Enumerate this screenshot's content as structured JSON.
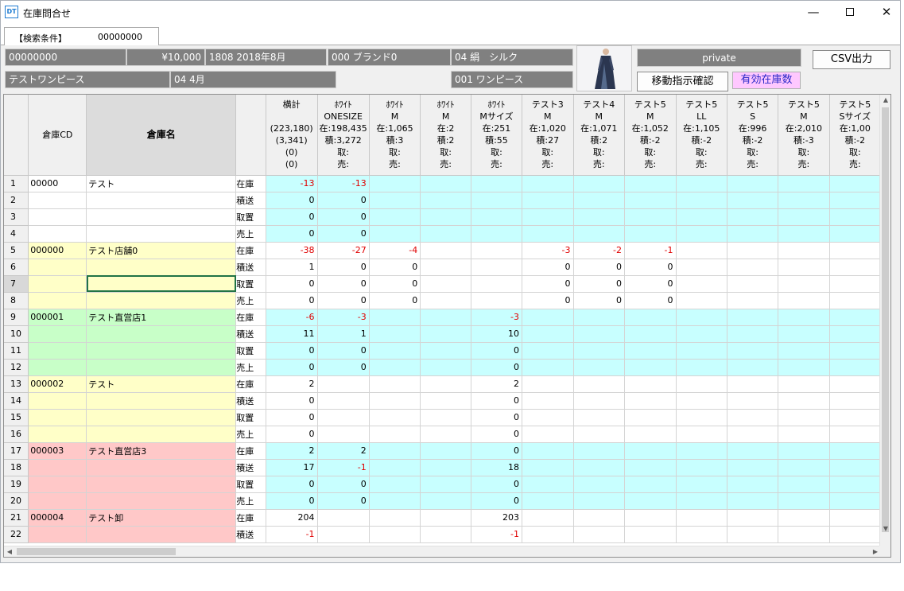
{
  "window": {
    "icon_text": "DT",
    "title": "在庫問合せ",
    "controls": {
      "minimize": "—",
      "close": "✕"
    }
  },
  "tab": {
    "label": "【検索条件】",
    "value": "00000000"
  },
  "info": {
    "code": "00000000",
    "price": "¥10,000",
    "season": "1808 2018年8月",
    "brand": "000 ブランド0",
    "material": "04 絹　シルク",
    "product_name": "テストワンピース",
    "month": "04 4月",
    "category": "001 ワンピース"
  },
  "buttons": {
    "private": "private",
    "move_confirm": "移動指示確認",
    "valid_stock": "有効在庫数",
    "csv": "CSV出力"
  },
  "grid": {
    "headers": {
      "warehouse_cd": "倉庫CD",
      "warehouse_name": "倉庫名",
      "cols": [
        [
          "横計",
          "",
          "(223,180)",
          "(3,341)",
          "(0)",
          "(0)"
        ],
        [
          "ﾎﾜｲﾄ",
          "ONESIZE",
          "在:198,435",
          "積:3,272",
          "取:",
          "売:"
        ],
        [
          "ﾎﾜｲﾄ",
          "M",
          "在:1,065",
          "積:3",
          "取:",
          "売:"
        ],
        [
          "ﾎﾜｲﾄ",
          "M",
          "在:2",
          "積:2",
          "取:",
          "売:"
        ],
        [
          "ﾎﾜｲﾄ",
          "Mサイズ",
          "在:251",
          "積:55",
          "取:",
          "売:"
        ],
        [
          "テスト3",
          "M",
          "在:1,020",
          "積:27",
          "取:",
          "売:"
        ],
        [
          "テスト4",
          "M",
          "在:1,071",
          "積:2",
          "取:",
          "売:"
        ],
        [
          "テスト5",
          "M",
          "在:1,052",
          "積:-2",
          "取:",
          "売:"
        ],
        [
          "テスト5",
          "LL",
          "在:1,105",
          "積:-2",
          "取:",
          "売:"
        ],
        [
          "テスト5",
          "S",
          "在:996",
          "積:-2",
          "取:",
          "売:"
        ],
        [
          "テスト5",
          "M",
          "在:2,010",
          "積:-3",
          "取:",
          "売:"
        ],
        [
          "テスト5",
          "Sサイズ",
          "在:1,00",
          "積:-2",
          "取:",
          "売:"
        ]
      ]
    },
    "groups": [
      {
        "cd": "00000",
        "name": "テスト",
        "color": "#ffffff",
        "data_color": "#c8ffff",
        "rows": [
          {
            "n": "1",
            "label": "在庫",
            "v": [
              "-13",
              "-13",
              "",
              "",
              "",
              "",
              "",
              "",
              "",
              "",
              "",
              ""
            ]
          },
          {
            "n": "2",
            "label": "積送",
            "v": [
              "0",
              "0",
              "",
              "",
              "",
              "",
              "",
              "",
              "",
              "",
              "",
              ""
            ]
          },
          {
            "n": "3",
            "label": "取置",
            "v": [
              "0",
              "0",
              "",
              "",
              "",
              "",
              "",
              "",
              "",
              "",
              "",
              ""
            ]
          },
          {
            "n": "4",
            "label": "売上",
            "v": [
              "0",
              "0",
              "",
              "",
              "",
              "",
              "",
              "",
              "",
              "",
              "",
              ""
            ]
          }
        ]
      },
      {
        "cd": "000000",
        "name": "テスト店舗0",
        "color": "#ffffc8",
        "data_color": "#ffffff",
        "rows": [
          {
            "n": "5",
            "label": "在庫",
            "v": [
              "-38",
              "-27",
              "-4",
              "",
              "",
              "-3",
              "-2",
              "-1",
              "",
              "",
              "",
              ""
            ]
          },
          {
            "n": "6",
            "label": "積送",
            "v": [
              "1",
              "0",
              "0",
              "",
              "",
              "0",
              "0",
              "0",
              "",
              "",
              "",
              ""
            ]
          },
          {
            "n": "7",
            "label": "取置",
            "v": [
              "0",
              "0",
              "0",
              "",
              "",
              "0",
              "0",
              "0",
              "",
              "",
              "",
              ""
            ]
          },
          {
            "n": "8",
            "label": "売上",
            "v": [
              "0",
              "0",
              "0",
              "",
              "",
              "0",
              "0",
              "0",
              "",
              "",
              "",
              ""
            ]
          }
        ]
      },
      {
        "cd": "000001",
        "name": "テスト直営店1",
        "color": "#c8ffc8",
        "data_color": "#c8ffff",
        "rows": [
          {
            "n": "9",
            "label": "在庫",
            "v": [
              "-6",
              "-3",
              "",
              "",
              "-3",
              "",
              "",
              "",
              "",
              "",
              "",
              ""
            ]
          },
          {
            "n": "10",
            "label": "積送",
            "v": [
              "11",
              "1",
              "",
              "",
              "10",
              "",
              "",
              "",
              "",
              "",
              "",
              ""
            ]
          },
          {
            "n": "11",
            "label": "取置",
            "v": [
              "0",
              "0",
              "",
              "",
              "0",
              "",
              "",
              "",
              "",
              "",
              "",
              ""
            ]
          },
          {
            "n": "12",
            "label": "売上",
            "v": [
              "0",
              "0",
              "",
              "",
              "0",
              "",
              "",
              "",
              "",
              "",
              "",
              ""
            ]
          }
        ]
      },
      {
        "cd": "000002",
        "name": "テスト",
        "color": "#ffffc8",
        "data_color": "#ffffff",
        "rows": [
          {
            "n": "13",
            "label": "在庫",
            "v": [
              "2",
              "",
              "",
              "",
              "2",
              "",
              "",
              "",
              "",
              "",
              "",
              ""
            ]
          },
          {
            "n": "14",
            "label": "積送",
            "v": [
              "0",
              "",
              "",
              "",
              "0",
              "",
              "",
              "",
              "",
              "",
              "",
              ""
            ]
          },
          {
            "n": "15",
            "label": "取置",
            "v": [
              "0",
              "",
              "",
              "",
              "0",
              "",
              "",
              "",
              "",
              "",
              "",
              ""
            ]
          },
          {
            "n": "16",
            "label": "売上",
            "v": [
              "0",
              "",
              "",
              "",
              "0",
              "",
              "",
              "",
              "",
              "",
              "",
              ""
            ]
          }
        ]
      },
      {
        "cd": "000003",
        "name": "テスト直営店3",
        "color": "#ffc8c8",
        "data_color": "#c8ffff",
        "rows": [
          {
            "n": "17",
            "label": "在庫",
            "v": [
              "2",
              "2",
              "",
              "",
              "0",
              "",
              "",
              "",
              "",
              "",
              "",
              ""
            ]
          },
          {
            "n": "18",
            "label": "積送",
            "v": [
              "17",
              "-1",
              "",
              "",
              "18",
              "",
              "",
              "",
              "",
              "",
              "",
              ""
            ]
          },
          {
            "n": "19",
            "label": "取置",
            "v": [
              "0",
              "0",
              "",
              "",
              "0",
              "",
              "",
              "",
              "",
              "",
              "",
              ""
            ]
          },
          {
            "n": "20",
            "label": "売上",
            "v": [
              "0",
              "0",
              "",
              "",
              "0",
              "",
              "",
              "",
              "",
              "",
              "",
              ""
            ]
          }
        ]
      },
      {
        "cd": "000004",
        "name": "テスト卸",
        "color": "#ffc8c8",
        "data_color": "#ffffff",
        "rows": [
          {
            "n": "21",
            "label": "在庫",
            "v": [
              "204",
              "",
              "",
              "",
              "203",
              "",
              "",
              "",
              "",
              "",
              "",
              ""
            ]
          },
          {
            "n": "22",
            "label": "積送",
            "v": [
              "-1",
              "",
              "",
              "",
              "-1",
              "",
              "",
              "",
              "",
              "",
              "",
              ""
            ]
          }
        ]
      }
    ],
    "selected_row": "7"
  }
}
